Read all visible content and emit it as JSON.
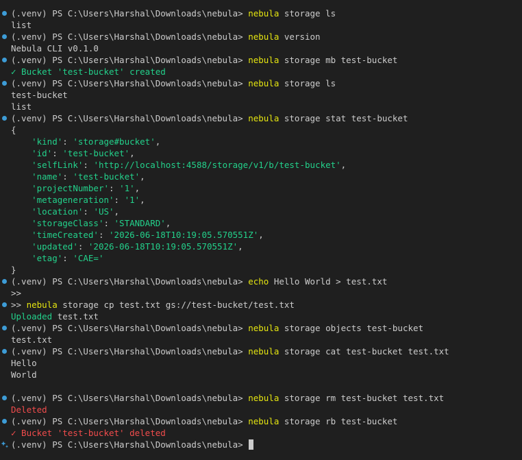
{
  "colors": {
    "background": "#1f1f1f",
    "text": "#cccccc",
    "command": "#e5e510",
    "string": "#23d18b",
    "success": "#23d18b",
    "error": "#f14c4c",
    "decoration": "#3d9cd6"
  },
  "icons": {
    "prompt_marker": "command-decoration-dot-icon",
    "input_marker": "sparkle-icon"
  },
  "lines": [
    {
      "deco": "dot",
      "parts": [
        {
          "t": "(.venv) PS C:\\Users\\Harshal\\Downloads\\nebula> "
        },
        {
          "t": "nebula",
          "c": "command"
        },
        {
          "t": " storage ls"
        }
      ]
    },
    {
      "parts": [
        {
          "t": "list"
        }
      ]
    },
    {
      "deco": "dot",
      "parts": [
        {
          "t": "(.venv) PS C:\\Users\\Harshal\\Downloads\\nebula> "
        },
        {
          "t": "nebula",
          "c": "command"
        },
        {
          "t": " version"
        }
      ]
    },
    {
      "parts": [
        {
          "t": "Nebula CLI v0.1.0"
        }
      ]
    },
    {
      "deco": "dot",
      "parts": [
        {
          "t": "(.venv) PS C:\\Users\\Harshal\\Downloads\\nebula> "
        },
        {
          "t": "nebula",
          "c": "command"
        },
        {
          "t": " storage mb test-bucket"
        }
      ]
    },
    {
      "parts": [
        {
          "t": "✓ Bucket 'test-bucket' created",
          "c": "success"
        }
      ]
    },
    {
      "deco": "dot",
      "parts": [
        {
          "t": "(.venv) PS C:\\Users\\Harshal\\Downloads\\nebula> "
        },
        {
          "t": "nebula",
          "c": "command"
        },
        {
          "t": " storage ls"
        }
      ]
    },
    {
      "parts": [
        {
          "t": "test-bucket"
        }
      ]
    },
    {
      "parts": [
        {
          "t": "list"
        }
      ]
    },
    {
      "deco": "dot",
      "parts": [
        {
          "t": "(.venv) PS C:\\Users\\Harshal\\Downloads\\nebula> "
        },
        {
          "t": "nebula",
          "c": "command"
        },
        {
          "t": " storage stat test-bucket"
        }
      ]
    },
    {
      "parts": [
        {
          "t": "{"
        }
      ]
    },
    {
      "parts": [
        {
          "t": "    "
        },
        {
          "t": "'kind'",
          "c": "string"
        },
        {
          "t": ": "
        },
        {
          "t": "'storage#bucket'",
          "c": "string"
        },
        {
          "t": ","
        }
      ]
    },
    {
      "parts": [
        {
          "t": "    "
        },
        {
          "t": "'id'",
          "c": "string"
        },
        {
          "t": ": "
        },
        {
          "t": "'test-bucket'",
          "c": "string"
        },
        {
          "t": ","
        }
      ]
    },
    {
      "parts": [
        {
          "t": "    "
        },
        {
          "t": "'selfLink'",
          "c": "string"
        },
        {
          "t": ": "
        },
        {
          "t": "'http://localhost:4588/storage/v1/b/test-bucket'",
          "c": "string"
        },
        {
          "t": ","
        }
      ]
    },
    {
      "parts": [
        {
          "t": "    "
        },
        {
          "t": "'name'",
          "c": "string"
        },
        {
          "t": ": "
        },
        {
          "t": "'test-bucket'",
          "c": "string"
        },
        {
          "t": ","
        }
      ]
    },
    {
      "parts": [
        {
          "t": "    "
        },
        {
          "t": "'projectNumber'",
          "c": "string"
        },
        {
          "t": ": "
        },
        {
          "t": "'1'",
          "c": "string"
        },
        {
          "t": ","
        }
      ]
    },
    {
      "parts": [
        {
          "t": "    "
        },
        {
          "t": "'metageneration'",
          "c": "string"
        },
        {
          "t": ": "
        },
        {
          "t": "'1'",
          "c": "string"
        },
        {
          "t": ","
        }
      ]
    },
    {
      "parts": [
        {
          "t": "    "
        },
        {
          "t": "'location'",
          "c": "string"
        },
        {
          "t": ": "
        },
        {
          "t": "'US'",
          "c": "string"
        },
        {
          "t": ","
        }
      ]
    },
    {
      "parts": [
        {
          "t": "    "
        },
        {
          "t": "'storageClass'",
          "c": "string"
        },
        {
          "t": ": "
        },
        {
          "t": "'STANDARD'",
          "c": "string"
        },
        {
          "t": ","
        }
      ]
    },
    {
      "parts": [
        {
          "t": "    "
        },
        {
          "t": "'timeCreated'",
          "c": "string"
        },
        {
          "t": ": "
        },
        {
          "t": "'2026-06-18T10:19:05.570551Z'",
          "c": "string"
        },
        {
          "t": ","
        }
      ]
    },
    {
      "parts": [
        {
          "t": "    "
        },
        {
          "t": "'updated'",
          "c": "string"
        },
        {
          "t": ": "
        },
        {
          "t": "'2026-06-18T10:19:05.570551Z'",
          "c": "string"
        },
        {
          "t": ","
        }
      ]
    },
    {
      "parts": [
        {
          "t": "    "
        },
        {
          "t": "'etag'",
          "c": "string"
        },
        {
          "t": ": "
        },
        {
          "t": "'CAE='",
          "c": "string"
        }
      ]
    },
    {
      "parts": [
        {
          "t": "}"
        }
      ]
    },
    {
      "deco": "dot",
      "parts": [
        {
          "t": "(.venv) PS C:\\Users\\Harshal\\Downloads\\nebula> "
        },
        {
          "t": "echo",
          "c": "command"
        },
        {
          "t": " Hello World > test.txt"
        }
      ]
    },
    {
      "parts": [
        {
          "t": ">>"
        }
      ]
    },
    {
      "deco": "dot",
      "parts": [
        {
          "t": ">> "
        },
        {
          "t": "nebula",
          "c": "command"
        },
        {
          "t": " storage cp test.txt gs://test-bucket/test.txt"
        }
      ]
    },
    {
      "parts": [
        {
          "t": "Uploaded",
          "c": "success"
        },
        {
          "t": " test.txt"
        }
      ]
    },
    {
      "deco": "dot",
      "parts": [
        {
          "t": "(.venv) PS C:\\Users\\Harshal\\Downloads\\nebula> "
        },
        {
          "t": "nebula",
          "c": "command"
        },
        {
          "t": " storage objects test-bucket"
        }
      ]
    },
    {
      "parts": [
        {
          "t": "test.txt"
        }
      ]
    },
    {
      "deco": "dot",
      "parts": [
        {
          "t": "(.venv) PS C:\\Users\\Harshal\\Downloads\\nebula> "
        },
        {
          "t": "nebula",
          "c": "command"
        },
        {
          "t": " storage cat test-bucket test.txt"
        }
      ]
    },
    {
      "parts": [
        {
          "t": "Hello"
        }
      ]
    },
    {
      "parts": [
        {
          "t": "World"
        }
      ]
    },
    {
      "parts": [
        {
          "t": ""
        }
      ]
    },
    {
      "deco": "dot",
      "parts": [
        {
          "t": "(.venv) PS C:\\Users\\Harshal\\Downloads\\nebula> "
        },
        {
          "t": "nebula",
          "c": "command"
        },
        {
          "t": " storage rm test-bucket test.txt"
        }
      ]
    },
    {
      "parts": [
        {
          "t": "Deleted",
          "c": "error"
        }
      ]
    },
    {
      "deco": "dot",
      "parts": [
        {
          "t": "(.venv) PS C:\\Users\\Harshal\\Downloads\\nebula> "
        },
        {
          "t": "nebula",
          "c": "command"
        },
        {
          "t": " storage rb test-bucket"
        }
      ]
    },
    {
      "parts": [
        {
          "t": "✓ Bucket 'test-bucket' deleted",
          "c": "error"
        }
      ]
    },
    {
      "deco": "sparkle",
      "cursor": true,
      "parts": [
        {
          "t": "(.venv) PS C:\\Users\\Harshal\\Downloads\\nebula> "
        }
      ]
    }
  ]
}
